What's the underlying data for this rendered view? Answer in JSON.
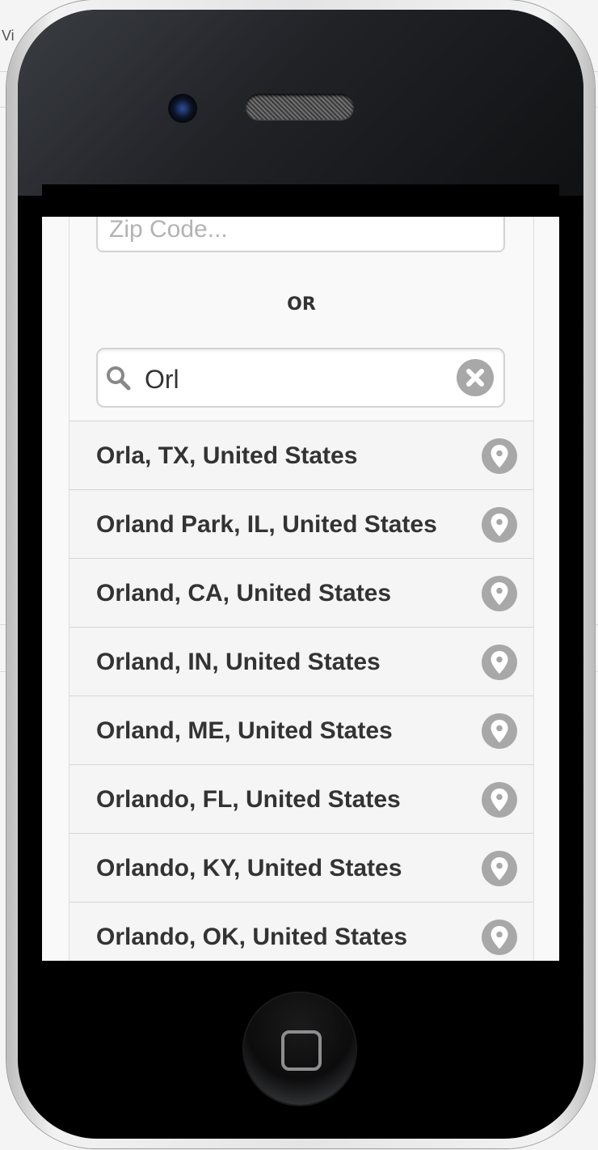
{
  "background": {
    "app_label": "Vi"
  },
  "form": {
    "zip_placeholder": "Zip Code...",
    "zip_value": "",
    "or_label": "OR",
    "search_value": "Orl"
  },
  "results": [
    {
      "label": "Orla, TX, United States"
    },
    {
      "label": "Orland Park, IL, United States"
    },
    {
      "label": "Orland, CA, United States"
    },
    {
      "label": "Orland, IN, United States"
    },
    {
      "label": "Orland, ME, United States"
    },
    {
      "label": "Orlando, FL, United States"
    },
    {
      "label": "Orlando, KY, United States"
    },
    {
      "label": "Orlando, OK, United States"
    }
  ],
  "icons": {
    "search": "search-icon",
    "clear": "clear-icon",
    "result": "location-pin-icon"
  },
  "colors": {
    "icon_gray": "#a8a8a8",
    "text": "#333333",
    "list_bg": "#f5f5f5"
  }
}
